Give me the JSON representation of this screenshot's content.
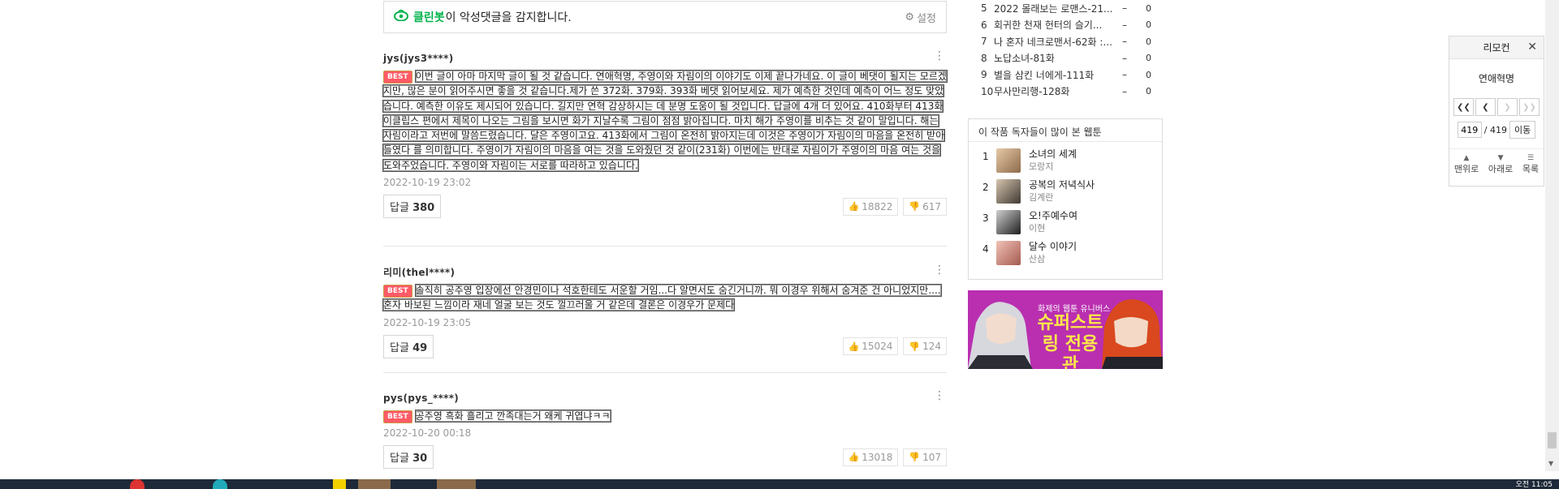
{
  "cleanbot": {
    "name": "클린봇",
    "message": "이 악성댓글을 감지합니다.",
    "settings_label": "설정"
  },
  "comments": [
    {
      "user": "jys(jys3****)",
      "badge": "BEST",
      "text": "이번 글이 아마 마지막 글이 될 것 같습니다. 연애혁명, 주영이와 자림이의 이야기도 이제 끝나가네요. 이 글이 베댓이 될지는 모르겠지만, 많은 분이 읽어주시면 좋을 것 같습니다.제가 쓴 372화. 379화. 393화 베댓 읽어보세요. 제가 예측한 것인데 예측이 어느 정도 맞았습니다. 예측한 이유도 제시되어 있습니다. 길지만 연혁 감상하시는 데 분명 도움이 될 것입니다. 답글에 4개 더 있어요. 410화부터 413화 이클립스 편에서 제목이 나오는 그림을 보시면 화가 지날수록 그림이 점점 밝아집니다. 마치 해가 주영이를 비추는 것 같이 말입니다. 해는 자림이라고 저번에 말씀드렸습니다. 달은 주영이고요. 413화에서 그림이 온전히 밝아지는데 이것은 주영이가 자림이의 마음을 온전히 받아들였다 를 의미합니다. 주영이가 자림이의 마음을 여는 것을 도와줬던 것 같이(231화) 이번에는 반대로 자림이가 주영이의 마음 여는 것을 도와주었습니다. 주영이와 자림이는 서로를 따라하고 있습니다.",
      "date": "2022-10-19 23:02",
      "reply_label": "답글",
      "reply_count": "380",
      "likes": "18822",
      "dislikes": "617"
    },
    {
      "user": "리미(thel****)",
      "badge": "BEST",
      "text": "솔직히 공주영 입장에선 안경민이나 석호한테도 서운할 거임...다 알면서도 숨긴거니까. 뭐 이경우 위해서 숨겨준 건 아니었지만.... 혼자 바보된 느낌이라 재네 얼굴 보는 것도 껄끄러울 거 같은데 결론은 이경우가 문제다",
      "date": "2022-10-19 23:05",
      "reply_label": "답글",
      "reply_count": "49",
      "likes": "15024",
      "dislikes": "124"
    },
    {
      "user": "pys(pys_****)",
      "badge": "BEST",
      "text": "공주영 흑화 흘리고 깐족대는거 왜케 귀엽냐ㅋㅋ",
      "date": "2022-10-20 00:18",
      "reply_label": "답글",
      "reply_count": "30",
      "likes": "13018",
      "dislikes": "107"
    }
  ],
  "ranking": [
    {
      "num": "5",
      "title": "2022 몰래보는 로맨스-21...",
      "dash": "–",
      "count": "0"
    },
    {
      "num": "6",
      "title": "회귀한 천재 헌터의 슬기...",
      "dash": "–",
      "count": "0"
    },
    {
      "num": "7",
      "title": "나 혼자 네크로맨서-62화 :...",
      "dash": "–",
      "count": "0"
    },
    {
      "num": "8",
      "title": "노답소녀-81화",
      "dash": "–",
      "count": "0"
    },
    {
      "num": "9",
      "title": "별을 삼킨 너에게-111화",
      "dash": "–",
      "count": "0"
    },
    {
      "num": "10",
      "title": "무사만리행-128화",
      "dash": "–",
      "count": "0"
    }
  ],
  "popular": {
    "title": "이 작품 독자들이 많이 본 웹툰",
    "items": [
      {
        "num": "1",
        "title": "소녀의 세계",
        "author": "모랑지",
        "color": "#c9a27a"
      },
      {
        "num": "2",
        "title": "공복의 저녁식사",
        "author": "김계란",
        "color": "#7a6a5a"
      },
      {
        "num": "3",
        "title": "오!주예수여",
        "author": "이현",
        "color": "#4a4a4a"
      },
      {
        "num": "4",
        "title": "달수 이야기",
        "author": "산삼",
        "color": "#d9958a"
      }
    ]
  },
  "banner": {
    "subtitle": "화제의 웹툰 유니버스",
    "title": "슈퍼스트링 전용관",
    "color": "#b92fb0"
  },
  "remote": {
    "header": "리모컨",
    "title": "연애혁명",
    "current_page": "419",
    "total_pages": "/ 419",
    "go_label": "이동",
    "foot": [
      "맨위로",
      "아래로",
      "목록"
    ]
  },
  "taskbar": {
    "clock": "오전 11:05"
  }
}
